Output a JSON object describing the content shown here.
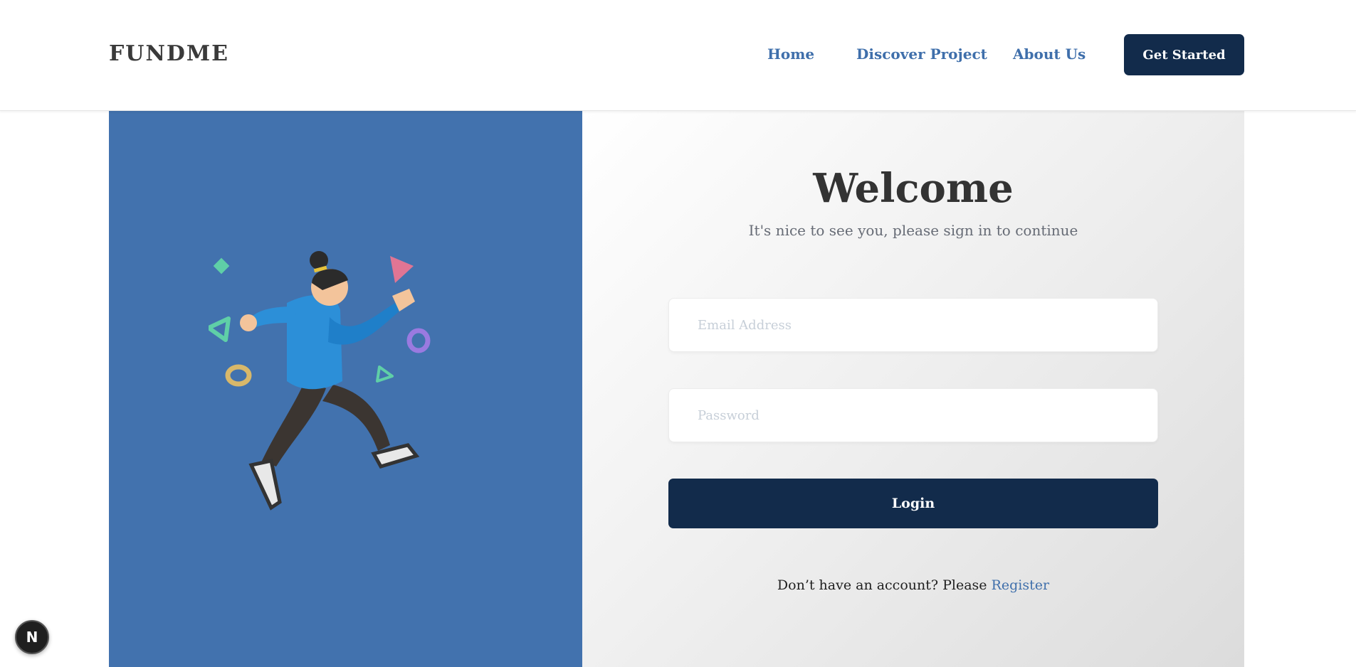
{
  "header": {
    "logo": "FUNDME",
    "nav": {
      "home": "Home",
      "discover": "Discover Project",
      "about": "About Us"
    },
    "cta_label": "Get Started"
  },
  "login": {
    "title": "Welcome",
    "subtitle": "It's nice to see you, please sign in to continue",
    "email_placeholder": "Email Address",
    "password_placeholder": "Password",
    "login_label": "Login",
    "register_prompt": "Don’t have an account? Please",
    "register_link": "Register"
  },
  "illustration": {
    "icon": "running-person-illustration",
    "panel_color": "#4272ae"
  },
  "badge": {
    "label": "N",
    "icon": "nextjs-icon"
  },
  "colors": {
    "primary": "#122b4b",
    "link": "#3f6fab",
    "panel": "#4272ae"
  }
}
